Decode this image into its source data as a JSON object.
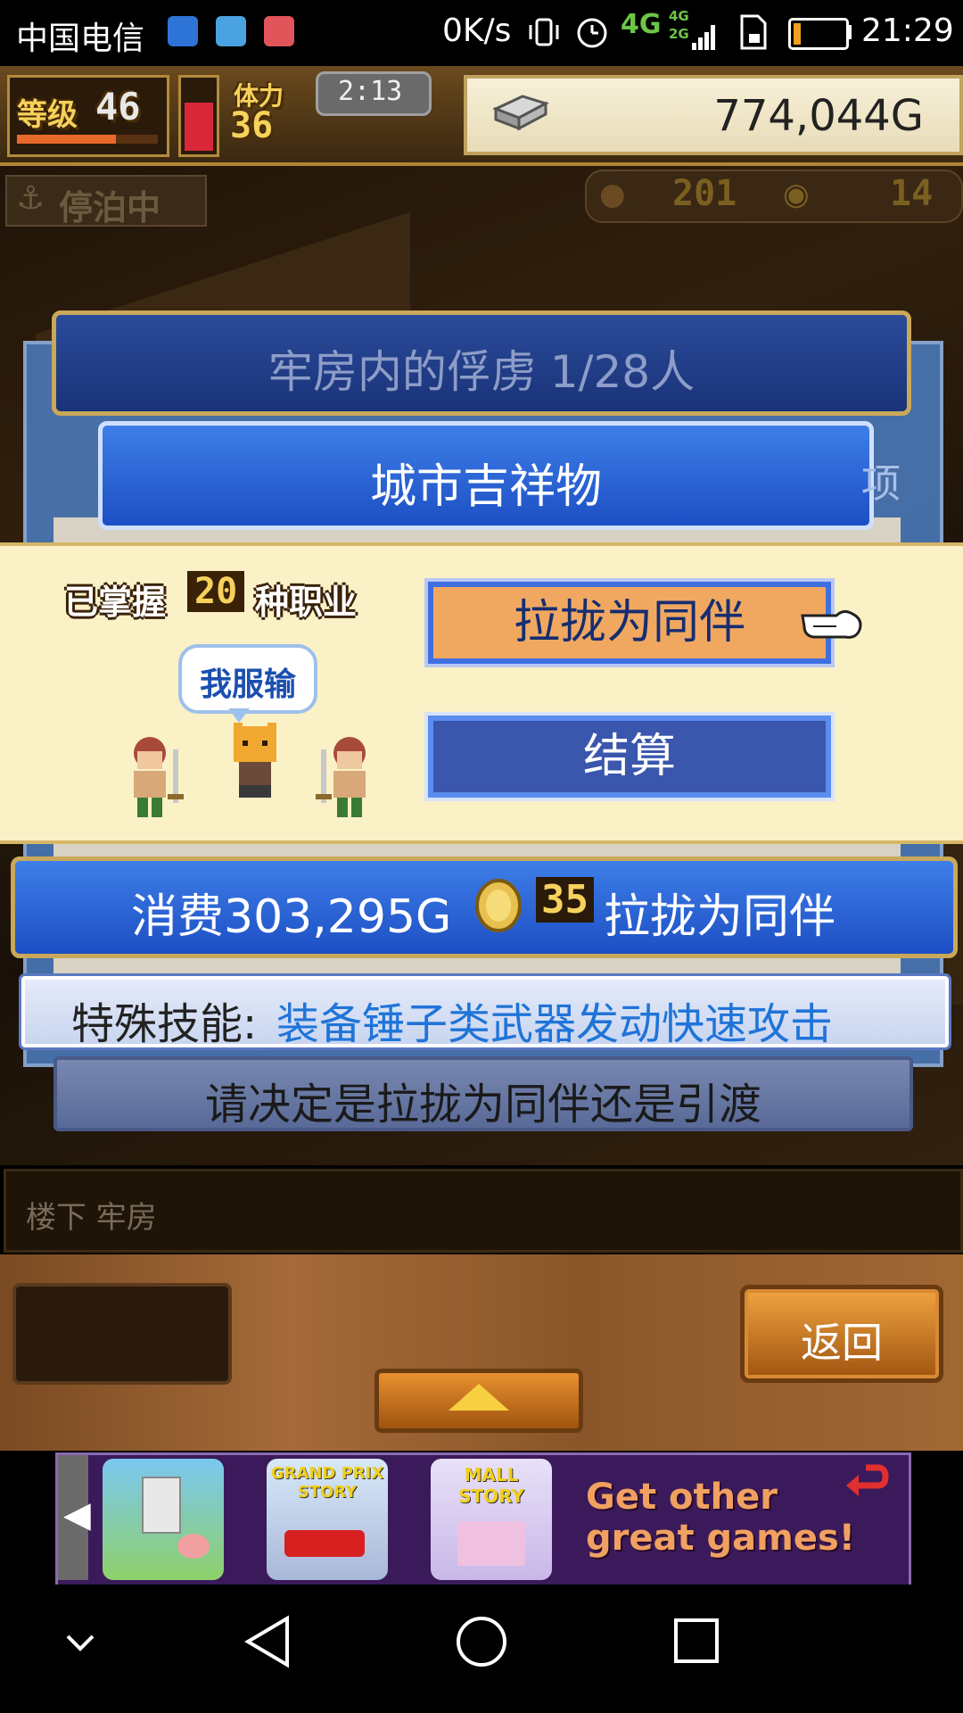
{
  "status_bar": {
    "carrier": "中国电信",
    "speed": "0K/s",
    "net_main": "4G",
    "net_sub_top": "4G",
    "net_sub_bottom": "2G",
    "time": "21:29"
  },
  "hud": {
    "level_label": "等级",
    "level_value": "46",
    "stamina_label": "体力",
    "stamina_value": "36",
    "timer": "2:13",
    "money": "774,044G",
    "docked_label": "停泊中",
    "food_count": "201",
    "medal_count": "14"
  },
  "dialog": {
    "title": "牢房内的俘虏  1/28人",
    "subtitle": "城市吉祥物",
    "side_fragment": "项",
    "jobs_prefix": "已掌握",
    "jobs_count": "20",
    "jobs_suffix": "种职业",
    "speech": "我服输",
    "recruit_button": "拉拢为同伴",
    "settle_button": "结算",
    "cost_prefix": "消费303,295G",
    "cost_medals": "35",
    "cost_suffix": "拉拢为同伴",
    "skill_label": "特殊技能:",
    "skill_text": "装备锤子类武器发动快速攻击",
    "prompt": "请决定是拉拢为同伴还是引渡"
  },
  "location": "楼下 牢房",
  "back_button": "返回",
  "ad_banner": {
    "game1": "",
    "game2": "GRAND PRIX STORY",
    "game3": "MALL STORY",
    "cta": "Get other great games!"
  },
  "colors": {
    "accent_blue": "#2f62d8",
    "button_orange": "#f0a860",
    "band_yellow": "#fbf1c7",
    "skill_blue": "#1f74d8"
  }
}
